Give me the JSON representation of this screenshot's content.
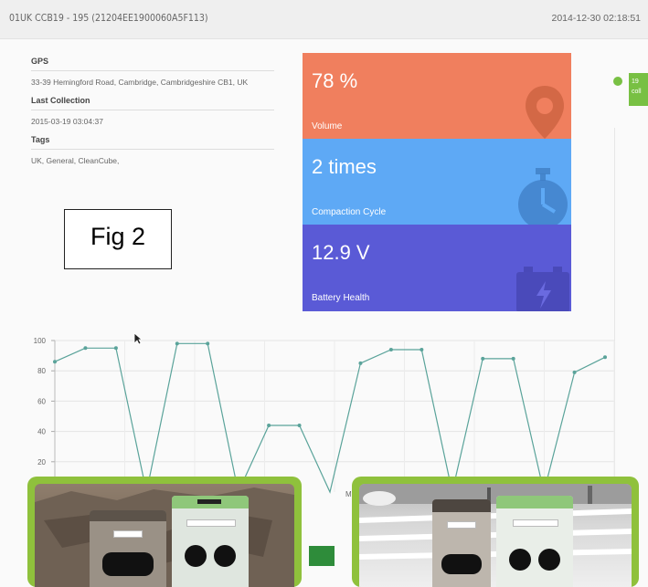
{
  "header": {
    "device_id": "01UK CCB19 - 195 (21204EE1900060A5F113)",
    "timestamp": "2014-12-30 02:18:51"
  },
  "info": {
    "gps_label": "GPS",
    "gps_value": "33-39 Hemingford Road, Cambridge, Cambridgeshire CB1, UK",
    "last_collection_label": "Last Collection",
    "last_collection_value": "2015-03-19 03:04:37",
    "tags_label": "Tags",
    "tags_value": "UK, General, CleanCube,"
  },
  "figure_label": "Fig 2",
  "tiles": [
    {
      "value": "78 %",
      "label": "Volume",
      "color": "#f07f5e",
      "icon": "location-pin-icon"
    },
    {
      "value": "2 times",
      "label": "Compaction Cycle",
      "color": "#5ea9f5",
      "icon": "stopwatch-icon"
    },
    {
      "value": "12.9 V",
      "label": "Battery Health",
      "color": "#5a5ad6",
      "icon": "battery-icon"
    }
  ],
  "side_tab": {
    "text": "19 coll"
  },
  "chart_data": {
    "type": "line",
    "title": "",
    "xlabel": "",
    "ylabel": "",
    "ylim": [
      0,
      100
    ],
    "yticks": [
      20,
      40,
      60,
      80,
      100
    ],
    "x_tick_visible": "M",
    "grid": true,
    "series": [
      {
        "values": [
          86,
          95,
          95,
          0,
          98,
          98,
          0,
          44,
          44,
          0,
          85,
          94,
          94,
          0,
          88,
          88,
          0,
          79,
          89
        ],
        "color": "#5aa39a"
      }
    ]
  },
  "photos": [
    {
      "name": "bins-photo-left"
    },
    {
      "name": "bins-photo-right"
    }
  ]
}
